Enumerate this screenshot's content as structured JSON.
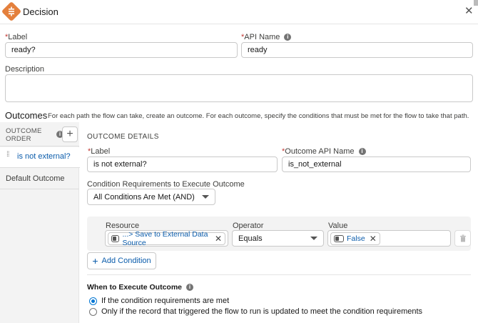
{
  "header": {
    "title": "Decision",
    "close_icon": "close-icon",
    "type_icon": "decision-icon",
    "icon_color": "#e4803d"
  },
  "label_field": {
    "label": "Label",
    "value": "ready?"
  },
  "api_name_field": {
    "label": "API Name",
    "value": "ready"
  },
  "description_field": {
    "label": "Description",
    "value": ""
  },
  "outcomes": {
    "title": "Outcomes",
    "description": "For each path the flow can take, create an outcome. For each outcome, specify the conditions that must be met for the flow to take that path."
  },
  "sidebar": {
    "heading_line1": "OUTCOME",
    "heading_line2": "ORDER",
    "add_label": "+",
    "items": [
      {
        "label": "is not external?",
        "selected": true
      },
      {
        "label": "Default Outcome",
        "selected": false
      }
    ]
  },
  "details": {
    "title": "OUTCOME DETAILS",
    "label": {
      "label": "Label",
      "value": "is not external?"
    },
    "api_name": {
      "label": "Outcome API Name",
      "value": "is_not_external"
    },
    "condition_requirements": {
      "label": "Condition Requirements to Execute Outcome",
      "value": "All Conditions Are Met (AND)"
    },
    "condition": {
      "resource_label": "Resource",
      "resource_value": "...> Save to External Data Source",
      "operator_label": "Operator",
      "operator_value": "Equals",
      "value_label": "Value",
      "value_value": "False"
    },
    "add_condition": "Add Condition",
    "when_title": "When to Execute Outcome",
    "when_options": [
      {
        "label": "If the condition requirements are met",
        "checked": true
      },
      {
        "label": "Only if the record that triggered the flow to run is updated to meet the condition requirements",
        "checked": false
      }
    ]
  },
  "colors": {
    "accent": "#0176d3",
    "link": "#0b5cab",
    "required": "#c23934"
  }
}
